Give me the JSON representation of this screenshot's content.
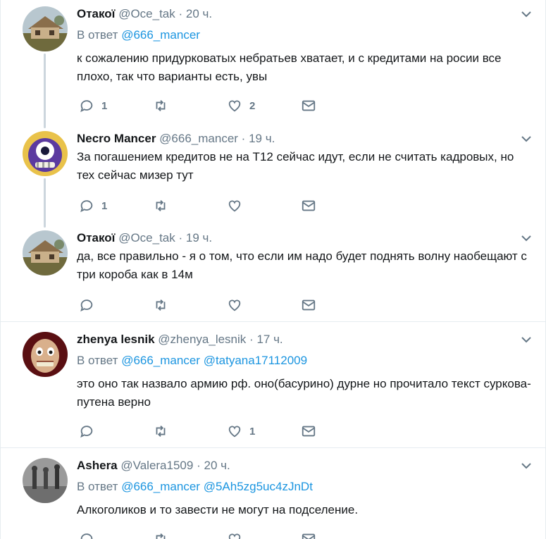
{
  "tweets": [
    {
      "name": "Отакої",
      "handle": "@Oce_tak",
      "time": "20 ч.",
      "reply_prefix": "В ответ",
      "reply_mentions": [
        "@666_mancer"
      ],
      "text": "к сожалению придурковатых небратьев хватает, и с кредитами на росии все плохо, так что варианты есть, увы",
      "replies": "1",
      "retweets": "",
      "likes": "2"
    },
    {
      "name": "Necro Mancer",
      "handle": "@666_mancer",
      "time": "19 ч.",
      "text": "За погашением кредитов не на Т12 сейчас идут, если не считать кадровых, но тех сейчас мизер тут",
      "replies": "1",
      "retweets": "",
      "likes": ""
    },
    {
      "name": "Отакої",
      "handle": "@Oce_tak",
      "time": "19 ч.",
      "text": "да, все правильно - я о том, что если им надо будет поднять волну наобещают с три короба как в 14м",
      "replies": "",
      "retweets": "",
      "likes": ""
    },
    {
      "name": "zhenya lesnik",
      "handle": "@zhenya_lesnik",
      "time": "17 ч.",
      "reply_prefix": "В ответ",
      "reply_mentions": [
        "@666_mancer",
        "@tatyana17112009"
      ],
      "text": "это оно так назвало армию рф. оно(басурино) дурне но прочитало текст суркова-путена верно",
      "replies": "",
      "retweets": "",
      "likes": "1"
    },
    {
      "name": "Ashera",
      "handle": "@Valera1509",
      "time": "20 ч.",
      "reply_prefix": "В ответ",
      "reply_mentions": [
        "@666_mancer",
        "@5Ah5zg5uc4zJnDt"
      ],
      "text": "Алкоголиков и то завести не могут на подселение.",
      "replies": "",
      "retweets": "",
      "likes": ""
    }
  ],
  "separator": "·",
  "colors": {
    "text": "#14171a",
    "muted": "#657786",
    "link": "#1b95e0",
    "divider": "#e6ecf0",
    "thread_line": "#ccd6dd"
  },
  "icons": [
    "reply-icon",
    "retweet-icon",
    "like-icon",
    "message-icon",
    "chevron-down-icon"
  ]
}
